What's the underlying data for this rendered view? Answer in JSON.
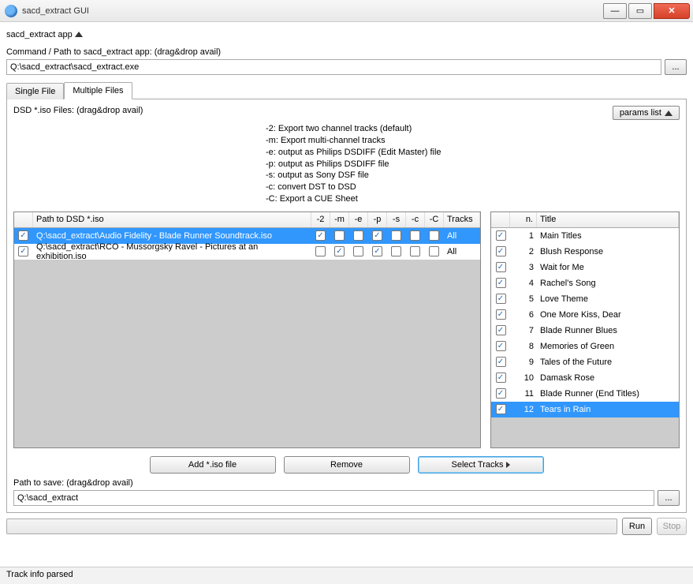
{
  "window": {
    "title": "sacd_extract GUI"
  },
  "header": {
    "app_label": "sacd_extract app",
    "path_label": "Command / Path to sacd_extract app: (drag&drop avail)",
    "path_value": "Q:\\sacd_extract\\sacd_extract.exe"
  },
  "tabs": {
    "single": "Single File",
    "multiple": "Multiple Files"
  },
  "main": {
    "iso_label": "DSD *.iso Files: (drag&drop avail)",
    "params_btn": "params list",
    "options": [
      "-2: Export two channel tracks (default)",
      "-m: Export multi-channel tracks",
      "-e: output as Philips DSDIFF (Edit Master) file",
      "-p: output as Philips DSDIFF file",
      "-s: output as Sony DSF file",
      "-c: convert DST to DSD",
      "-C: Export a CUE Sheet"
    ],
    "grid": {
      "headers": {
        "path": "Path to DSD *.iso",
        "opts": [
          "-2",
          "-m",
          "-e",
          "-p",
          "-s",
          "-c",
          "-C"
        ],
        "tracks": "Tracks"
      },
      "rows": [
        {
          "selected": true,
          "checked": true,
          "path": "Q:\\sacd_extract\\Audio Fidelity - Blade Runner Soundtrack.iso",
          "opts": [
            true,
            false,
            false,
            true,
            false,
            false,
            false
          ],
          "tracks": "All"
        },
        {
          "selected": false,
          "checked": true,
          "path": "Q:\\sacd_extract\\RCO - Mussorgsky Ravel - Pictures at an exhibition.iso",
          "opts": [
            false,
            true,
            false,
            true,
            false,
            false,
            false
          ],
          "tracks": "All"
        }
      ]
    },
    "tracks_panel": {
      "headers": {
        "n": "n.",
        "title": "Title"
      },
      "rows": [
        {
          "n": 1,
          "title": "Main Titles"
        },
        {
          "n": 2,
          "title": "Blush Response"
        },
        {
          "n": 3,
          "title": "Wait for Me"
        },
        {
          "n": 4,
          "title": "Rachel's Song"
        },
        {
          "n": 5,
          "title": "Love Theme"
        },
        {
          "n": 6,
          "title": "One More Kiss, Dear"
        },
        {
          "n": 7,
          "title": "Blade Runner Blues"
        },
        {
          "n": 8,
          "title": "Memories of Green"
        },
        {
          "n": 9,
          "title": "Tales of the Future"
        },
        {
          "n": 10,
          "title": "Damask Rose"
        },
        {
          "n": 11,
          "title": "Blade Runner (End Titles)"
        },
        {
          "n": 12,
          "title": "Tears in Rain",
          "selected": true
        }
      ]
    },
    "buttons": {
      "add": "Add *.iso file",
      "remove": "Remove",
      "select_tracks": "Select Tracks"
    },
    "save_label": "Path to save: (drag&drop avail)",
    "save_value": "Q:\\sacd_extract"
  },
  "footer": {
    "run": "Run",
    "stop": "Stop"
  },
  "status": "Track info parsed"
}
